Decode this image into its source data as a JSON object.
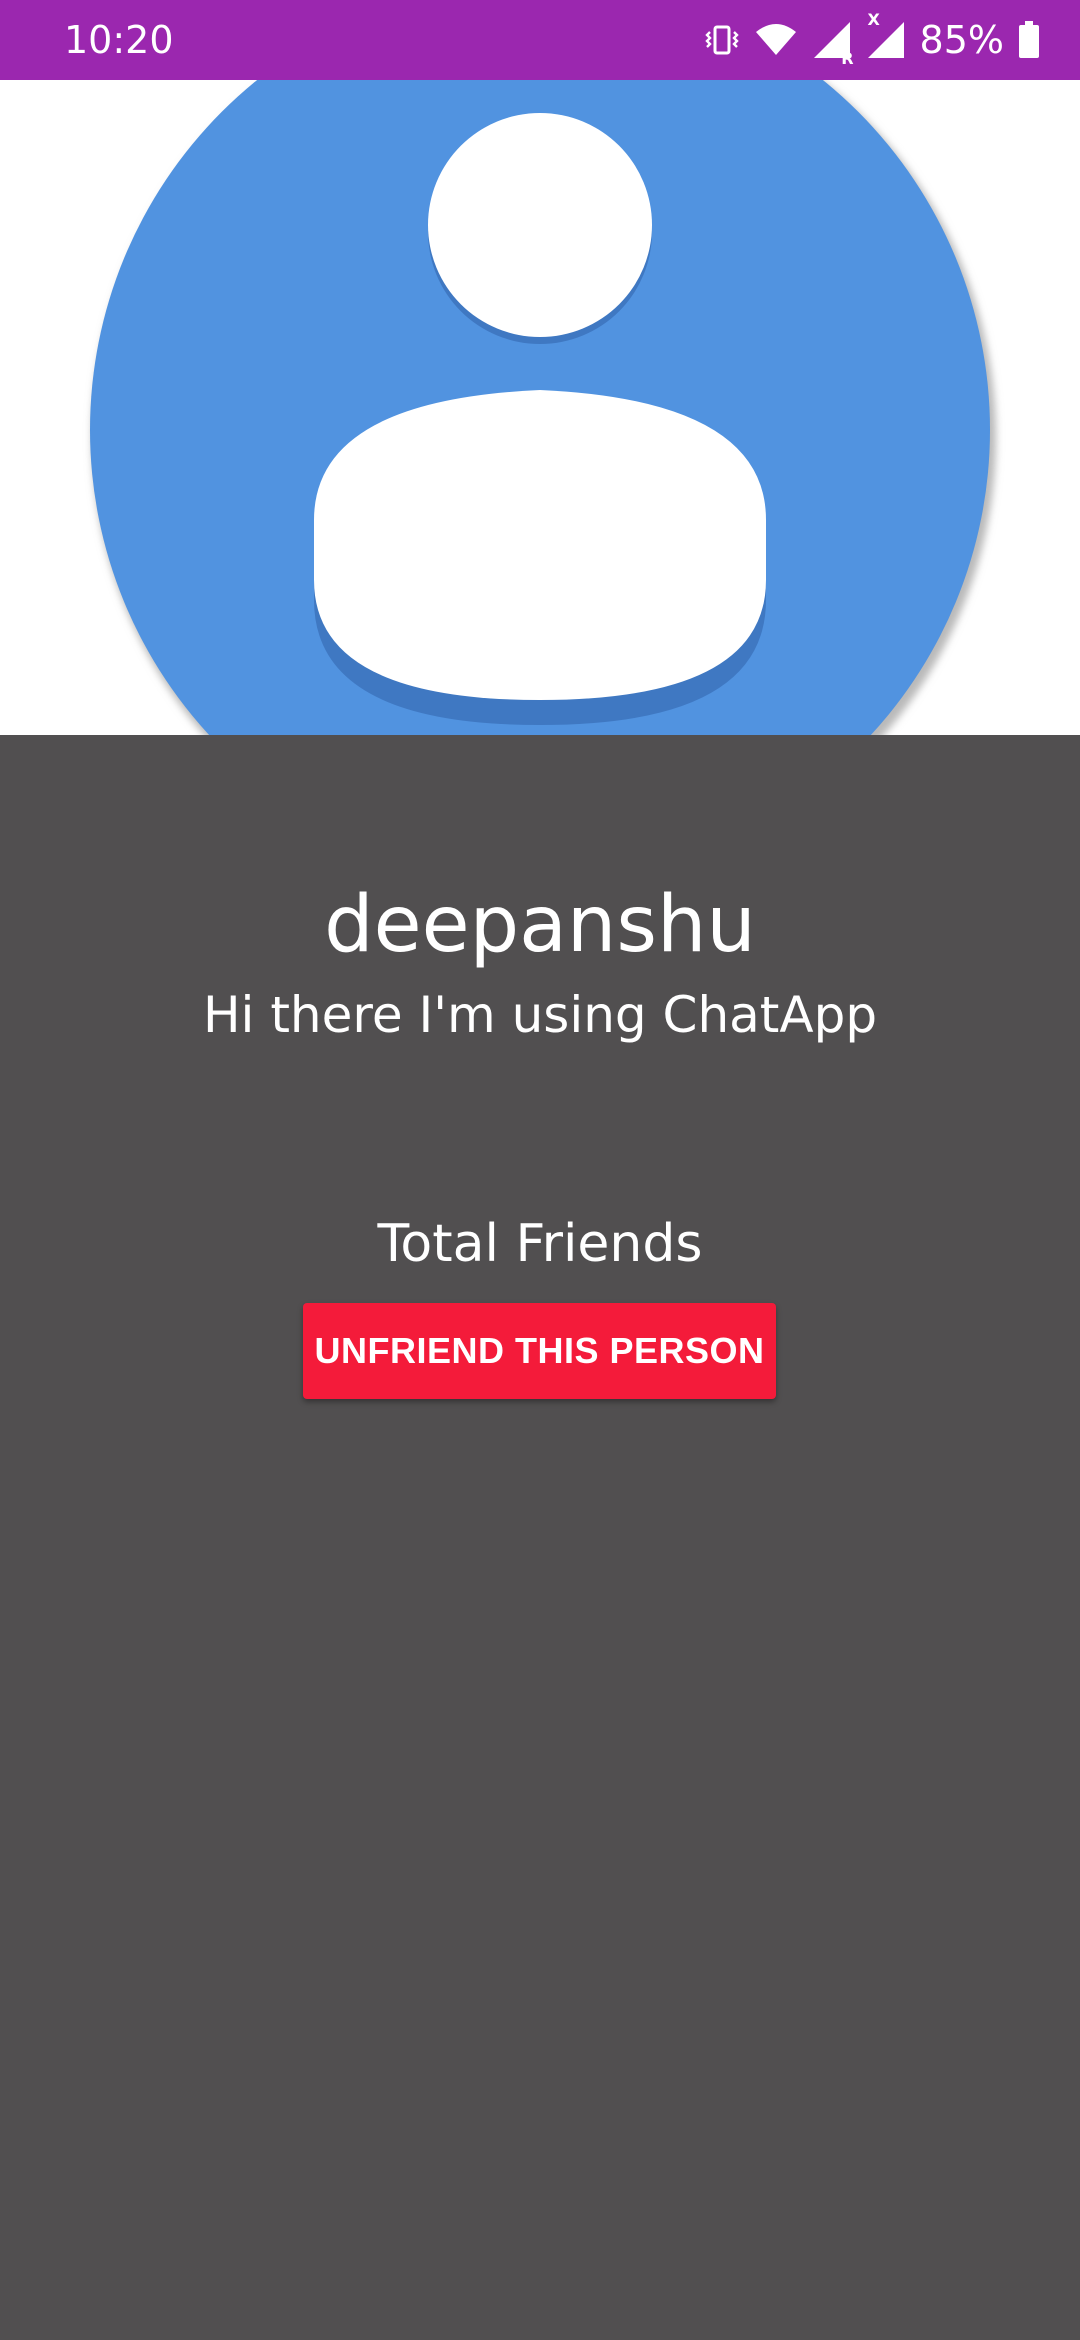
{
  "status_bar": {
    "time": "10:20",
    "battery_percent": "85%",
    "icons": [
      "vibrate-icon",
      "wifi-icon",
      "signal-roaming-icon",
      "signal-no-data-icon",
      "battery-icon"
    ],
    "signal_roaming_label": "R",
    "signal_no_data_label": "X",
    "background_color": "#9b27af"
  },
  "profile": {
    "image_icon": "default-avatar-icon",
    "avatar_color": "#5193e0",
    "name": "deepanshu",
    "status": "Hi there I'm using ChatApp",
    "total_friends_label": "Total Friends",
    "unfriend_button_label": "UNFRIEND THIS PERSON",
    "button_color": "#f41b3a",
    "background_color": "#514f50"
  }
}
